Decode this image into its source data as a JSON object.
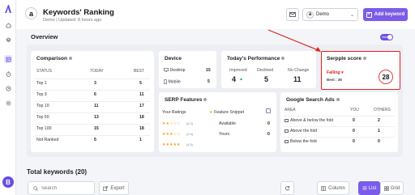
{
  "header": {
    "brand_letter": "a",
    "title": "Keywords' Ranking",
    "subtitle": "Demo | Updated: 8 hours ago",
    "project_letter": "a",
    "project_name": "Demo",
    "add_keyword_label": "Add keyword"
  },
  "sidebar": {
    "avatar_letter": "B"
  },
  "overview": {
    "title": "Overview",
    "toggle_label": "Hide"
  },
  "comparison": {
    "title": "Comparison",
    "headers": {
      "status": "STATUS",
      "today": "TODAY",
      "best": "BEST"
    },
    "rows": [
      {
        "status": "Top 1",
        "today": "3",
        "best": "5"
      },
      {
        "status": "Top 3",
        "today": "6",
        "best": "11"
      },
      {
        "status": "Top 10",
        "today": "11",
        "best": "17"
      },
      {
        "status": "Top 50",
        "today": "13",
        "best": "18"
      },
      {
        "status": "Top 100",
        "today": "15",
        "best": "18"
      },
      {
        "status": "Not Ranked",
        "today": "5",
        "best": "1"
      }
    ]
  },
  "device": {
    "title": "Device",
    "rows": [
      {
        "label": "Desktop",
        "value": "15"
      },
      {
        "label": "Mobile",
        "value": "5"
      }
    ]
  },
  "performance": {
    "title": "Today's Performance",
    "improved": {
      "label": "Improved",
      "value": "4"
    },
    "declined": {
      "label": "Declined",
      "value": "5"
    },
    "no_change": {
      "label": "No Change",
      "value": "11"
    }
  },
  "serpple": {
    "title": "Serpple score",
    "status": "Falling",
    "best_label": "Best : 38",
    "score": "28"
  },
  "serp_features": {
    "title": "SERP Features",
    "col_ratings": "Your Ratings",
    "col_snippet": "Feature Snippet",
    "rows": [
      {
        "stars": 2,
        "range": "(0-2)",
        "label": "Available",
        "value": "0"
      },
      {
        "stars": 3,
        "range": "(2-4)",
        "label": "Yours",
        "value": "0"
      },
      {
        "stars": 5,
        "range": "(4-5)",
        "label": "",
        "value": ""
      }
    ]
  },
  "ads": {
    "title": "Google Search Ads",
    "headers": {
      "area": "AREA",
      "you": "YOU",
      "others": "OTHERS"
    },
    "rows": [
      {
        "area": "Above & below the fold",
        "you": "0",
        "others": "2"
      },
      {
        "area": "Above the fold",
        "you": "0",
        "others": "1"
      },
      {
        "area": "Below the fold",
        "you": "0",
        "others": "0"
      }
    ]
  },
  "keywords": {
    "title": "Total keywords (20)",
    "search_placeholder": "Search",
    "export_label": "Export",
    "column_label": "Column",
    "list_label": "List",
    "grid_label": "Grid"
  },
  "colors": {
    "accent": "#7b5ce8",
    "highlight": "#e0241b",
    "improved": "#1db954",
    "falling": "#e0241b",
    "star": "#f4a020"
  }
}
